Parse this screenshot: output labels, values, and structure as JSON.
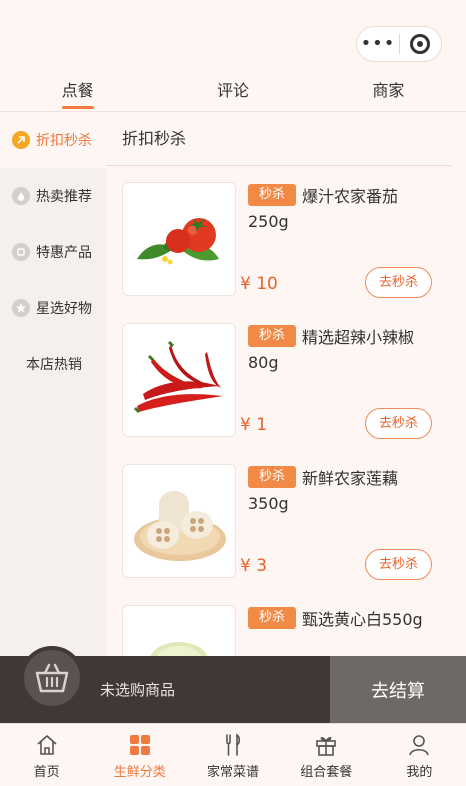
{
  "topbar": {
    "more_glyph": "•••"
  },
  "tabs": [
    {
      "label": "点餐",
      "active": true
    },
    {
      "label": "评论",
      "active": false
    },
    {
      "label": "商家",
      "active": false
    }
  ],
  "sidebar": {
    "items": [
      {
        "label": "折扣秒杀",
        "active": true
      },
      {
        "label": "热卖推荐",
        "active": false
      },
      {
        "label": "特惠产品",
        "active": false
      },
      {
        "label": "星选好物",
        "active": false
      },
      {
        "label": "本店热销",
        "active": false
      }
    ]
  },
  "content": {
    "category_title": "折扣秒杀",
    "products": [
      {
        "badge": "秒杀",
        "name": "爆汁农家番茄250g",
        "price": "¥ 10",
        "button": "去秒杀",
        "image": "tomato"
      },
      {
        "badge": "秒杀",
        "name": "精选超辣小辣椒80g",
        "price": "¥ 1",
        "button": "去秒杀",
        "image": "chili"
      },
      {
        "badge": "秒杀",
        "name": "新鲜农家莲藕350g",
        "price": "¥ 3",
        "button": "去秒杀",
        "image": "lotus-root"
      },
      {
        "badge": "秒杀",
        "name": "甄选黄心白550g",
        "price": "",
        "button": "",
        "image": "cabbage"
      }
    ]
  },
  "cart": {
    "status": "未选购商品",
    "checkout": "去结算"
  },
  "bottom_nav": [
    {
      "label": "首页",
      "icon": "home-icon",
      "active": false
    },
    {
      "label": "生鲜分类",
      "icon": "grid-icon",
      "active": true
    },
    {
      "label": "家常菜谱",
      "icon": "utensils-icon",
      "active": false
    },
    {
      "label": "组合套餐",
      "icon": "gift-icon",
      "active": false
    },
    {
      "label": "我的",
      "icon": "user-icon",
      "active": false
    }
  ],
  "colors": {
    "accent": "#f07a3f",
    "badge": "#f28a47",
    "price": "#e8632a",
    "cart_dark": "#3f3837",
    "checkout_bg": "#6e6866"
  }
}
